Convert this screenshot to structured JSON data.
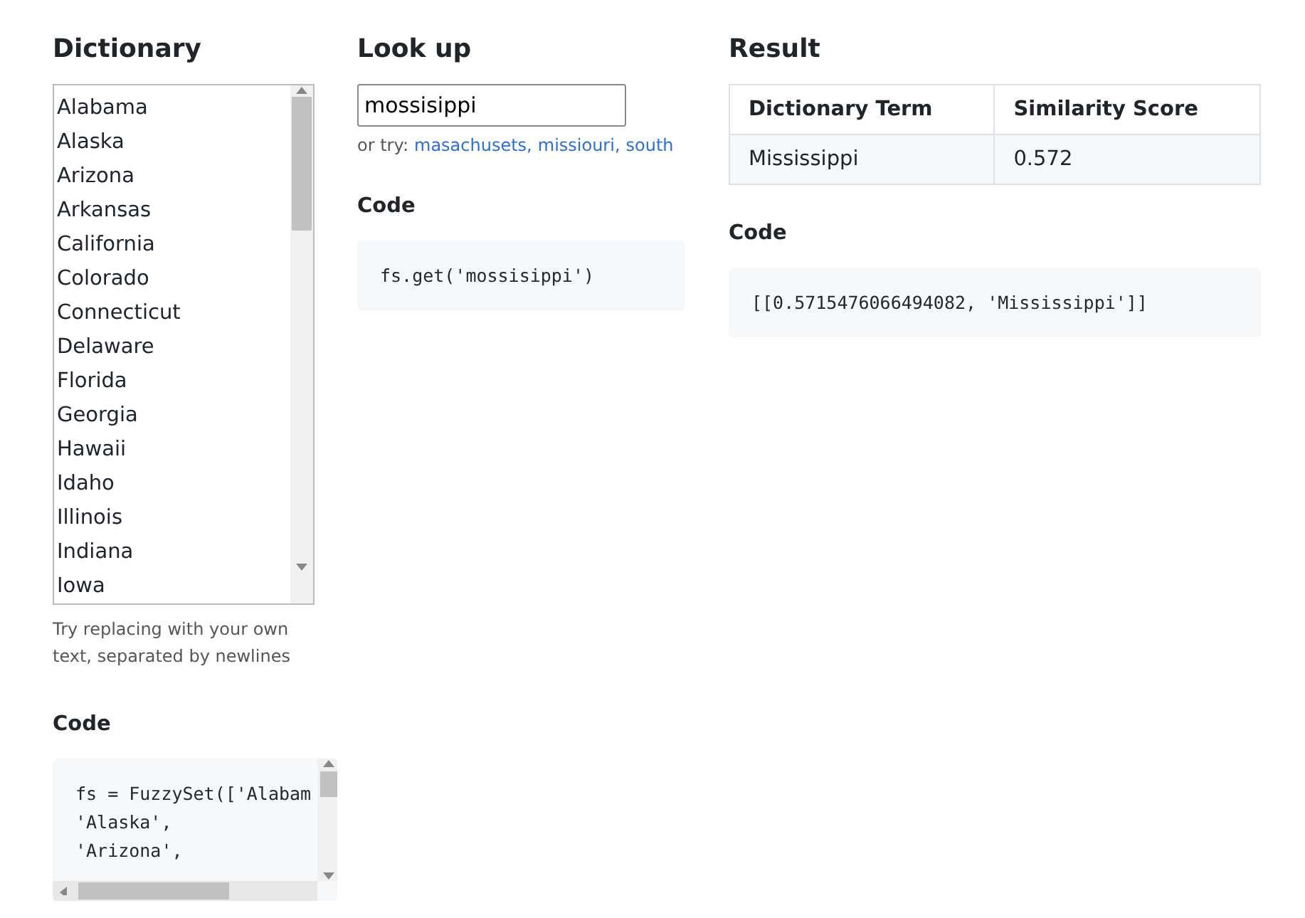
{
  "dictionary": {
    "heading": "Dictionary",
    "terms": [
      "Alabama",
      "Alaska",
      "Arizona",
      "Arkansas",
      "California",
      "Colorado",
      "Connecticut",
      "Delaware",
      "Florida",
      "Georgia",
      "Hawaii",
      "Idaho",
      "Illinois",
      "Indiana",
      "Iowa"
    ],
    "hint": "Try replacing with your own text, separated by newlines",
    "code_heading": "Code",
    "code_lines": [
      "fs = FuzzySet(['Alabam",
      "'Alaska',",
      "'Arizona',"
    ]
  },
  "lookup": {
    "heading": "Look up",
    "value": "mossisippi",
    "try_label": "or try:",
    "suggestions": [
      "masachusets,",
      "missiouri,",
      "south"
    ],
    "code_heading": "Code",
    "code": "fs.get('mossisippi')"
  },
  "result": {
    "heading": "Result",
    "columns": [
      "Dictionary Term",
      "Similarity Score"
    ],
    "rows": [
      [
        "Mississippi",
        "0.572"
      ]
    ],
    "code_heading": "Code",
    "code": "[[0.5715476066494082, 'Mississippi']]"
  }
}
